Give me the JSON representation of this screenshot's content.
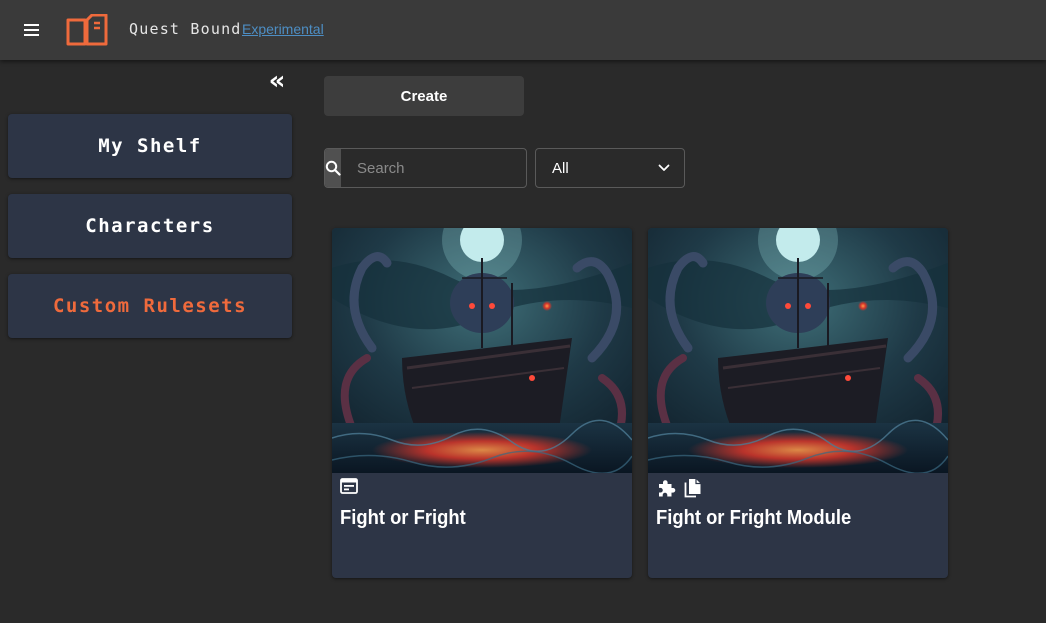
{
  "app": {
    "title": "Quest Bound",
    "badge": "Experimental"
  },
  "colors": {
    "accent": "#ef6a3c",
    "link": "#4d8ec4",
    "card_bg": "#2d3546",
    "topbar_bg": "#3a3a3a",
    "page_bg": "#2a2a2a"
  },
  "sidebar": {
    "collapse_icon": "double-chevron-left-icon",
    "collapse_glyph": "«",
    "items": [
      {
        "label": "My Shelf",
        "active": false
      },
      {
        "label": "Characters",
        "active": false
      },
      {
        "label": "Custom Rulesets",
        "active": true
      }
    ]
  },
  "toolbar": {
    "create_label": "Create",
    "search_placeholder": "Search",
    "search_icon": "search-icon",
    "filter_value": "All"
  },
  "cards": [
    {
      "title": "Fight or Fright",
      "icons": [
        "web-asset-icon"
      ]
    },
    {
      "title": "Fight or Fright Module",
      "icons": [
        "puzzle-piece-icon",
        "copy-icon"
      ]
    }
  ]
}
